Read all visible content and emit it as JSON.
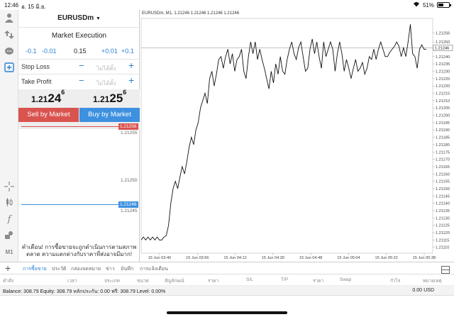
{
  "status_bar": {
    "time": "12:46",
    "date": "อ. 15 มิ.ย.",
    "battery": "51%",
    "battery_level": 0.51
  },
  "order_panel": {
    "symbol": "EURUSDm",
    "execution_title": "Market Execution",
    "volume_steps": [
      "-0.1",
      "-0.01",
      "0.15",
      "+0.01",
      "+0.1"
    ],
    "stop_loss": {
      "label": "Stop Loss",
      "placeholder": "ไม่ได้ตั้ง"
    },
    "take_profit": {
      "label": "Take Profit",
      "placeholder": "ไม่ได้ตั้ง"
    },
    "sell_price": {
      "prefix": "1.21",
      "big": "24",
      "sup": "6"
    },
    "buy_price": {
      "prefix": "1.21",
      "big": "25",
      "sup": "6"
    },
    "sell_button": "Sell by Market",
    "buy_button": "Buy by Market",
    "mini_chart": {
      "ask": "1.21256",
      "level_top": "1.21255",
      "level_mid": "1.21250",
      "bid": "1.21246",
      "level_bottom": "1.21245"
    },
    "warning": "คำเตือน! การซื้อขายจะถูกดำเนินการตามสภาพตลาด ความแตกต่างกับราคาที่ส่งอาจมีมาก!"
  },
  "chart_data": {
    "type": "line",
    "title": "EURUSDm, M1, 1.21246 1.21246 1.21246 1.21246",
    "current_price": "1.21246",
    "ylim": [
      1.21106,
      1.21266
    ],
    "y_ticks": [
      "1.21256",
      "1.21250",
      "1.21245",
      "1.21240",
      "1.21235",
      "1.21230",
      "1.21225",
      "1.21220",
      "1.21215",
      "1.21210",
      "1.21205",
      "1.21200",
      "1.21195",
      "1.21190",
      "1.21185",
      "1.21180",
      "1.21175",
      "1.21170",
      "1.21165",
      "1.21160",
      "1.21155",
      "1.21150",
      "1.21145",
      "1.21140",
      "1.21135",
      "1.21130",
      "1.21125",
      "1.21120",
      "1.21115",
      "1.21110"
    ],
    "x_ticks": [
      "15 Jun 03:40",
      "15 Jun 03:56",
      "15 Jun 04:12",
      "15 Jun 04:30",
      "15 Jun 04:48",
      "15 Jun 05:04",
      "15 Jun 05:22",
      "15 Jun 05:38"
    ],
    "values": [
      1.21115,
      1.21117,
      1.21115,
      1.21117,
      1.21115,
      1.21117,
      1.21115,
      1.21117,
      1.21115,
      1.21115,
      1.21117,
      1.21118,
      1.21125,
      1.2114,
      1.2115,
      1.21155,
      1.2115,
      1.21158,
      1.21165,
      1.2116,
      1.21168,
      1.21178,
      1.21185,
      1.2118,
      1.2119,
      1.21195,
      1.21205,
      1.2121,
      1.21215,
      1.21208,
      1.21225,
      1.2123,
      1.2122,
      1.21228,
      1.21238,
      1.2124,
      1.21232,
      1.2124,
      1.21245,
      1.21235,
      1.21242,
      1.2123,
      1.21238,
      1.2124,
      1.21245,
      1.2123,
      1.21225,
      1.2124,
      1.2125,
      1.21242,
      1.2125,
      1.21238,
      1.21245,
      1.21238,
      1.21232,
      1.21225,
      1.21218,
      1.2123,
      1.21222,
      1.21235,
      1.21228,
      1.2124,
      1.2123,
      1.21228,
      1.21238,
      1.21245,
      1.2125,
      1.21242,
      1.21238,
      1.21246,
      1.2125,
      1.2124,
      1.2123,
      1.21232,
      1.21245,
      1.21252,
      1.21242,
      1.2125,
      1.2124,
      1.21232,
      1.2125,
      1.2124,
      1.21245,
      1.2125,
      1.21245,
      1.2123,
      1.21242,
      1.2125,
      1.21242,
      1.2123,
      1.21238,
      1.21232,
      1.21225,
      1.21232,
      1.21238,
      1.2123,
      1.21232,
      1.21236,
      1.21228,
      1.21232,
      1.2124,
      1.21238,
      1.21245,
      1.21238,
      1.21245,
      1.2125,
      1.21245,
      1.2124,
      1.2124,
      1.21243,
      1.21245,
      1.21247,
      1.2125,
      1.21247,
      1.2124,
      1.21246,
      1.2124,
      1.2125,
      1.21262,
      1.21242,
      1.2124,
      1.21232,
      1.21245,
      1.21248,
      1.21245,
      1.21245
    ]
  },
  "tabs": [
    "การซื้อขาย",
    "ประวัติ",
    "กล่องจดหมาย",
    "ข่าว",
    "บันทึก",
    "การแจ้งเตือน"
  ],
  "columns": [
    "คำสั่ง",
    "เวลา",
    "ประเภท",
    "ขนาด",
    "สัญลักษณ์",
    "ราคา",
    "S/L",
    "T/P",
    "ราคา",
    "Swap",
    "กำไร",
    "หมายเหตุ"
  ],
  "balance": {
    "text": "Balance: 308.79  Equity: 308.79  หลักประกัน: 0.00  ฟรี: 308.79  Level: 0.00%",
    "total": "0.00",
    "currency": "USD"
  }
}
